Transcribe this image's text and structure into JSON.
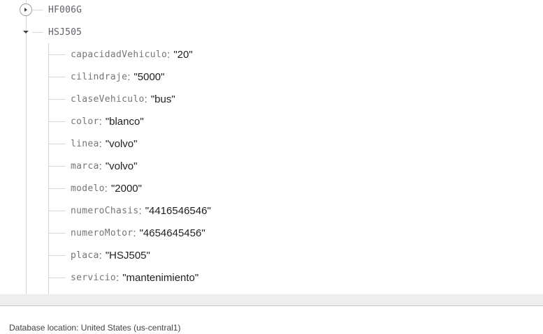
{
  "tree": {
    "nodes": [
      {
        "key": "HF006G",
        "state": "collapsed"
      },
      {
        "key": "HSJ505",
        "state": "expanded"
      }
    ],
    "fields": [
      {
        "key": "capacidadVehiculo",
        "value": "\"20\""
      },
      {
        "key": "cilindraje",
        "value": "\"5000\""
      },
      {
        "key": "claseVehiculo",
        "value": "\"bus\""
      },
      {
        "key": "color",
        "value": "\"blanco\""
      },
      {
        "key": "linea",
        "value": "\"volvo\""
      },
      {
        "key": "marca",
        "value": "\"volvo\""
      },
      {
        "key": "modelo",
        "value": "\"2000\""
      },
      {
        "key": "numeroChasis",
        "value": "\"4416546546\""
      },
      {
        "key": "numeroMotor",
        "value": "\"4654645456\""
      },
      {
        "key": "placa",
        "value": "\"HSJ505\""
      },
      {
        "key": "servicio",
        "value": "\"mantenimiento\""
      }
    ],
    "separator": ":"
  },
  "footer": {
    "location_text": "Database location: United States (us-central1)"
  },
  "icons": {
    "collapsed_toggle": "play-triangle-icon",
    "expanded_toggle": "caret-down-icon"
  },
  "colors": {
    "key_text": "#757575",
    "value_text": "#212121",
    "tree_lines": "#d6d6d6",
    "footer_band": "#eeeeee"
  }
}
